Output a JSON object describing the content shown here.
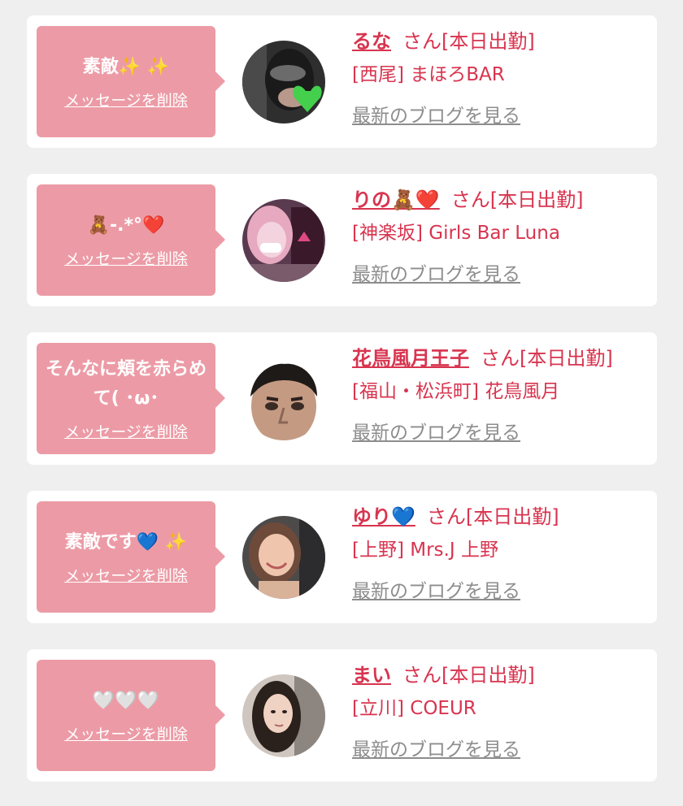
{
  "colors": {
    "background": "#efefef",
    "card": "#ffffff",
    "bubble": "#ec9ba6",
    "name": "#d8344f",
    "blog_link": "#8d8d8d"
  },
  "cards": [
    {
      "message": "素敵✨ ✨",
      "delete_label": "メッセージを削除",
      "name": "るな",
      "status": "さん[本日出勤]",
      "shop": "[西尾] まほろBAR",
      "blog_label": "最新のブログを見る",
      "avatar_icon": "masked-woman-green-heart-photo"
    },
    {
      "message": "🧸-.*°❤️",
      "delete_label": "メッセージを削除",
      "name": "りの🧸❤️",
      "status": "さん[本日出勤]",
      "shop": "[神楽坂] Girls Bar Luna",
      "blog_label": "最新のブログを見る",
      "avatar_icon": "woman-pink-light-photo"
    },
    {
      "message": "そんなに頬を赤らめて( ･ω･",
      "delete_label": "メッセージを削除",
      "name": "花鳥風月王子",
      "status": "さん[本日出勤]",
      "shop": "[福山・松浜町] 花鳥風月",
      "blog_label": "最新のブログを見る",
      "avatar_icon": "man-face-photo"
    },
    {
      "message": "素敵です💙 ✨",
      "delete_label": "メッセージを削除",
      "name": "ゆり💙",
      "status": "さん[本日出勤]",
      "shop": "[上野] Mrs.J 上野",
      "blog_label": "最新のブログを見る",
      "avatar_icon": "woman-smiling-photo"
    },
    {
      "message": "🤍🤍🤍",
      "delete_label": "メッセージを削除",
      "name": "まい",
      "status": "さん[本日出勤]",
      "shop": "[立川] COEUR",
      "blog_label": "最新のブログを見る",
      "avatar_icon": "woman-long-hair-photo"
    }
  ]
}
